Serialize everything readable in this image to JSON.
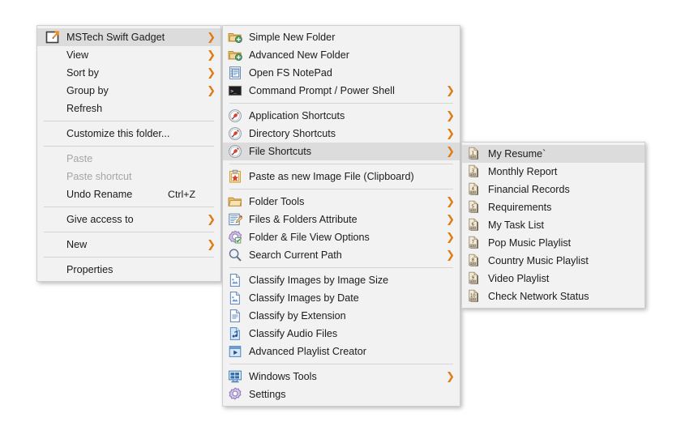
{
  "menus": {
    "context_menu": {
      "name": "folder-background-context-menu",
      "items": [
        {
          "label": "MSTech Swift Gadget",
          "icon": "mstech-swift-gadget-icon",
          "arrow": true,
          "highlighted": true,
          "disabled": false,
          "accel": ""
        },
        {
          "label": "View",
          "icon": "",
          "arrow": true,
          "highlighted": false,
          "disabled": false,
          "accel": ""
        },
        {
          "label": "Sort by",
          "icon": "",
          "arrow": true,
          "highlighted": false,
          "disabled": false,
          "accel": ""
        },
        {
          "label": "Group by",
          "icon": "",
          "arrow": true,
          "highlighted": false,
          "disabled": false,
          "accel": ""
        },
        {
          "label": "Refresh",
          "icon": "",
          "arrow": false,
          "highlighted": false,
          "disabled": false,
          "accel": ""
        },
        {
          "separator": true
        },
        {
          "label": "Customize this folder...",
          "icon": "",
          "arrow": false,
          "highlighted": false,
          "disabled": false,
          "accel": ""
        },
        {
          "separator": true
        },
        {
          "label": "Paste",
          "icon": "",
          "arrow": false,
          "highlighted": false,
          "disabled": true,
          "accel": ""
        },
        {
          "label": "Paste shortcut",
          "icon": "",
          "arrow": false,
          "highlighted": false,
          "disabled": true,
          "accel": ""
        },
        {
          "label": "Undo Rename",
          "icon": "",
          "arrow": false,
          "highlighted": false,
          "disabled": false,
          "accel": "Ctrl+Z"
        },
        {
          "separator": true
        },
        {
          "label": "Give access to",
          "icon": "",
          "arrow": true,
          "highlighted": false,
          "disabled": false,
          "accel": ""
        },
        {
          "separator": true
        },
        {
          "label": "New",
          "icon": "",
          "arrow": true,
          "highlighted": false,
          "disabled": false,
          "accel": ""
        },
        {
          "separator": true
        },
        {
          "label": "Properties",
          "icon": "",
          "arrow": false,
          "highlighted": false,
          "disabled": false,
          "accel": ""
        }
      ]
    },
    "swift_gadget_submenu": {
      "name": "mstech-swift-gadget-submenu",
      "items": [
        {
          "label": "Simple New Folder",
          "icon": "new-folder-icon",
          "arrow": false,
          "highlighted": false
        },
        {
          "label": "Advanced New Folder",
          "icon": "new-folder-icon",
          "arrow": false,
          "highlighted": false
        },
        {
          "label": "Open FS NotePad",
          "icon": "notepad-icon",
          "arrow": false,
          "highlighted": false
        },
        {
          "label": "Command Prompt / Power Shell",
          "icon": "console-icon",
          "arrow": true,
          "highlighted": false
        },
        {
          "separator": true
        },
        {
          "label": "Application Shortcuts",
          "icon": "pushpin-icon",
          "arrow": true,
          "highlighted": false
        },
        {
          "label": "Directory Shortcuts",
          "icon": "pushpin-icon",
          "arrow": true,
          "highlighted": false
        },
        {
          "label": "File Shortcuts",
          "icon": "pushpin-icon",
          "arrow": true,
          "highlighted": true
        },
        {
          "separator": true
        },
        {
          "label": "Paste as new Image File (Clipboard)",
          "icon": "clipboard-image-icon",
          "arrow": false,
          "highlighted": false
        },
        {
          "separator": true
        },
        {
          "label": "Folder Tools",
          "icon": "folder-icon",
          "arrow": true,
          "highlighted": false
        },
        {
          "label": "Files & Folders Attribute",
          "icon": "attribute-edit-icon",
          "arrow": true,
          "highlighted": false
        },
        {
          "label": "Folder & File View Options",
          "icon": "view-options-gear-icon",
          "arrow": true,
          "highlighted": false
        },
        {
          "label": "Search Current Path",
          "icon": "magnifier-icon",
          "arrow": true,
          "highlighted": false
        },
        {
          "separator": true
        },
        {
          "label": "Classify Images by Image Size",
          "icon": "image-file-icon",
          "arrow": false,
          "highlighted": false
        },
        {
          "label": "Classify Images by Date",
          "icon": "image-file-icon",
          "arrow": false,
          "highlighted": false
        },
        {
          "label": "Classify by Extension",
          "icon": "text-file-icon",
          "arrow": false,
          "highlighted": false
        },
        {
          "label": "Classify Audio Files",
          "icon": "audio-file-icon",
          "arrow": false,
          "highlighted": false
        },
        {
          "label": "Advanced Playlist Creator",
          "icon": "playlist-icon",
          "arrow": false,
          "highlighted": false
        },
        {
          "separator": true
        },
        {
          "label": "Windows Tools",
          "icon": "windows-tools-icon",
          "arrow": true,
          "highlighted": false
        },
        {
          "label": "Settings",
          "icon": "settings-gear-icon",
          "arrow": false,
          "highlighted": false
        }
      ]
    },
    "file_shortcuts_submenu": {
      "name": "file-shortcuts-submenu",
      "items": [
        {
          "label": "My Resume`",
          "icon": "file-shortcut-icon",
          "badge": "1",
          "highlighted": true
        },
        {
          "label": "Monthly Report",
          "icon": "file-shortcut-icon",
          "badge": "3",
          "highlighted": false
        },
        {
          "label": "Financial Records",
          "icon": "file-shortcut-icon",
          "badge": "4",
          "highlighted": false
        },
        {
          "label": "Requirements",
          "icon": "file-shortcut-icon",
          "badge": "5",
          "highlighted": false
        },
        {
          "label": "My Task List",
          "icon": "file-shortcut-icon",
          "badge": "6",
          "highlighted": false
        },
        {
          "label": "Pop Music Playlist",
          "icon": "file-shortcut-icon",
          "badge": "7",
          "highlighted": false
        },
        {
          "label": "Country Music Playlist",
          "icon": "file-shortcut-icon",
          "badge": "8",
          "highlighted": false
        },
        {
          "label": "Video Playlist",
          "icon": "file-shortcut-icon",
          "badge": "9",
          "highlighted": false
        },
        {
          "label": "Check Network Status",
          "icon": "file-shortcut-icon",
          "badge": "10",
          "highlighted": false
        }
      ]
    }
  },
  "colors": {
    "menu_background": "#f2f2f2",
    "menu_border": "#cfcfcf",
    "highlight": "#dcdcdc",
    "text": "#1b1b1b",
    "disabled_text": "#a6a6a6",
    "submenu_arrow": "#e07a12",
    "folder_gold": "#e8bd6d",
    "accent_green": "#4f9e6a"
  },
  "glyphs": {
    "submenu_arrow": "❯"
  }
}
